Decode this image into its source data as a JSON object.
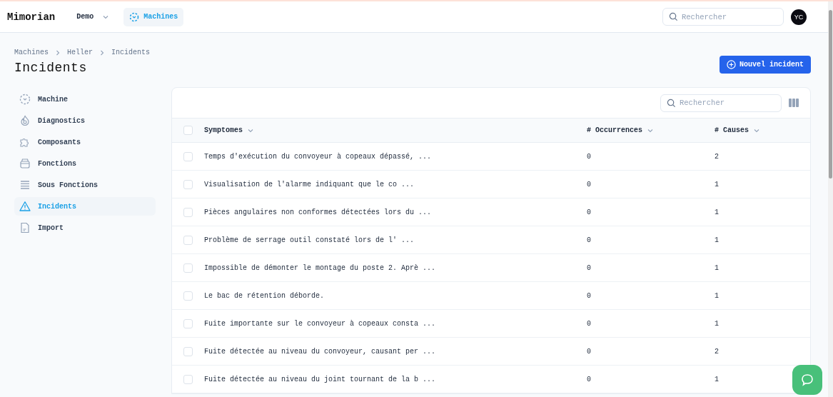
{
  "header": {
    "logo": "Mimorian",
    "workspace": "Demo",
    "nav": [
      {
        "label": "Machines",
        "selected": true
      }
    ],
    "search": {
      "placeholder": "Rechercher"
    },
    "avatar": "YC"
  },
  "breadcrumb": [
    "Machines",
    "Heller",
    "Incidents"
  ],
  "title": "Incidents",
  "primary_button": "Nouvel incident",
  "sidebar": {
    "items": [
      {
        "label": "Machine",
        "kind": "machine",
        "selected": false
      },
      {
        "label": "Diagnostics",
        "kind": "diagnostics",
        "selected": false
      },
      {
        "label": "Composants",
        "kind": "components",
        "selected": false
      },
      {
        "label": "Fonctions",
        "kind": "functions",
        "selected": false
      },
      {
        "label": "Sous Fonctions",
        "kind": "subfunctions",
        "selected": false
      },
      {
        "label": "Incidents",
        "kind": "incidents",
        "selected": true
      },
      {
        "label": "Import",
        "kind": "import",
        "selected": false
      }
    ]
  },
  "table": {
    "search": {
      "placeholder": "Rechercher"
    },
    "select_all_checked": false,
    "columns": [
      "Symptomes",
      "# Occurrences",
      "# Causes"
    ],
    "rows": [
      {
        "checked": false,
        "cells": [
          "Temps d'exécution du convoyeur à copeaux dépassé, ...",
          "0",
          "2"
        ]
      },
      {
        "checked": false,
        "cells": [
          "Visualisation de l'alarme indiquant que le co ...",
          "0",
          "1"
        ]
      },
      {
        "checked": false,
        "cells": [
          "Pièces angulaires non conformes détectées lors du ...",
          "0",
          "1"
        ]
      },
      {
        "checked": false,
        "cells": [
          "Problème de serrage outil constaté lors de l' ...",
          "0",
          "1"
        ]
      },
      {
        "checked": false,
        "cells": [
          "Impossible de démonter le montage du poste 2. Aprè ...",
          "0",
          "1"
        ]
      },
      {
        "checked": false,
        "cells": [
          "Le bac de rétention déborde.",
          "0",
          "1"
        ]
      },
      {
        "checked": false,
        "cells": [
          "Fuite importante sur le convoyeur à copeaux consta ...",
          "0",
          "1"
        ]
      },
      {
        "checked": false,
        "cells": [
          "Fuite détectée au niveau du convoyeur, causant per ...",
          "0",
          "2"
        ]
      },
      {
        "checked": false,
        "cells": [
          "Fuite détectée au niveau du joint tournant de la b ...",
          "0",
          "1"
        ]
      }
    ]
  }
}
